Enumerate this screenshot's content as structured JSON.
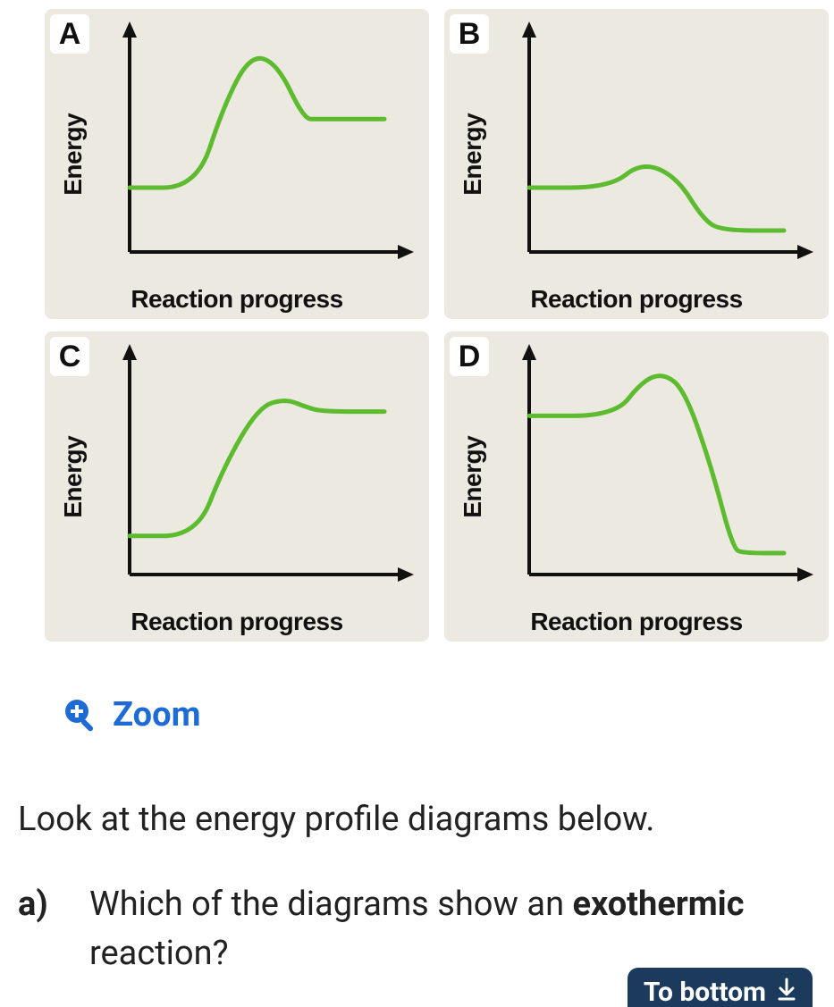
{
  "chart_data": [
    {
      "id": "A",
      "type": "line",
      "xlabel": "Reaction progress",
      "ylabel": "Energy",
      "x_range": [
        0,
        100
      ],
      "y_range": [
        0,
        100
      ],
      "description": "Endothermic profile: reactants low, barrier peak, products higher than reactants",
      "key_levels": {
        "reactants": 30,
        "transition_state": 92,
        "products": 62
      },
      "points": [
        {
          "x": 0,
          "y": 30
        },
        {
          "x": 25,
          "y": 30
        },
        {
          "x": 35,
          "y": 68
        },
        {
          "x": 45,
          "y": 92
        },
        {
          "x": 55,
          "y": 88
        },
        {
          "x": 65,
          "y": 62
        },
        {
          "x": 70,
          "y": 62
        },
        {
          "x": 95,
          "y": 62
        }
      ]
    },
    {
      "id": "B",
      "type": "line",
      "xlabel": "Reaction progress",
      "ylabel": "Energy",
      "x_range": [
        0,
        100
      ],
      "y_range": [
        0,
        100
      ],
      "description": "Exothermic profile: reactants mid, small barrier, products lower",
      "key_levels": {
        "reactants": 30,
        "transition_state": 42,
        "products": 10
      },
      "points": [
        {
          "x": 0,
          "y": 30
        },
        {
          "x": 30,
          "y": 30
        },
        {
          "x": 42,
          "y": 42
        },
        {
          "x": 55,
          "y": 35
        },
        {
          "x": 65,
          "y": 15
        },
        {
          "x": 72,
          "y": 10
        },
        {
          "x": 95,
          "y": 10
        }
      ]
    },
    {
      "id": "C",
      "type": "line",
      "xlabel": "Reaction progress",
      "ylabel": "Energy",
      "x_range": [
        0,
        100
      ],
      "y_range": [
        0,
        100
      ],
      "description": "Endothermic profile: reactants low, barrier, products high plateau just below peak",
      "key_levels": {
        "reactants": 18,
        "transition_state": 82,
        "products": 76
      },
      "points": [
        {
          "x": 0,
          "y": 18
        },
        {
          "x": 25,
          "y": 18
        },
        {
          "x": 35,
          "y": 50
        },
        {
          "x": 48,
          "y": 78
        },
        {
          "x": 58,
          "y": 82
        },
        {
          "x": 66,
          "y": 78
        },
        {
          "x": 72,
          "y": 76
        },
        {
          "x": 95,
          "y": 76
        }
      ]
    },
    {
      "id": "D",
      "type": "line",
      "xlabel": "Reaction progress",
      "ylabel": "Energy",
      "x_range": [
        0,
        100
      ],
      "y_range": [
        0,
        100
      ],
      "description": "Exothermic profile: reactants high, barrier above, steep drop to low products",
      "key_levels": {
        "reactants": 74,
        "transition_state": 94,
        "products": 10
      },
      "points": [
        {
          "x": 0,
          "y": 74
        },
        {
          "x": 32,
          "y": 74
        },
        {
          "x": 42,
          "y": 90
        },
        {
          "x": 50,
          "y": 94
        },
        {
          "x": 58,
          "y": 86
        },
        {
          "x": 68,
          "y": 50
        },
        {
          "x": 76,
          "y": 12
        },
        {
          "x": 80,
          "y": 10
        },
        {
          "x": 95,
          "y": 10
        }
      ]
    }
  ],
  "zoom_label": "Zoom",
  "intro_text": "Look at the energy profile diagrams below.",
  "question": {
    "part_label": "a)",
    "text_before_bold": "Which of the diagrams show an ",
    "bold_word": "exothermic",
    "text_after_bold": " reaction?"
  },
  "to_bottom_label": "To bottom",
  "colors": {
    "curve": "#5dbb2f",
    "axis": "#111111",
    "link": "#1e6bd6",
    "button_bg": "#1c3b5c"
  }
}
